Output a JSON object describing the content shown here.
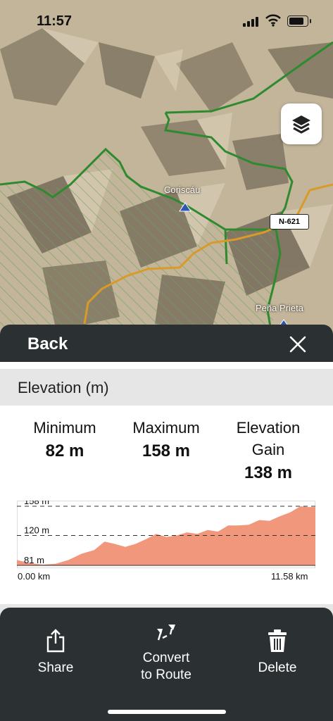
{
  "status_bar": {
    "time": "11:57"
  },
  "map": {
    "labels": {
      "place_1": "Coriscáu",
      "place_2": "Peña Prieta",
      "road": "N-621"
    },
    "icons": {
      "layers": "layers-icon",
      "peak": "mountain-peak-icon"
    }
  },
  "panel": {
    "back_label": "Back",
    "close_icon": "close-icon",
    "section_title": "Elevation (m)",
    "stats": [
      {
        "label": "Minimum",
        "value": "82 m"
      },
      {
        "label": "Maximum",
        "value": "158 m"
      },
      {
        "label": "Elevation Gain",
        "value": "138 m"
      }
    ]
  },
  "chart_data": {
    "type": "area",
    "title": "",
    "xlabel": "",
    "ylabel": "",
    "x_unit": "km",
    "y_unit": "m",
    "x_range": [
      0,
      11.58
    ],
    "ylim": [
      81,
      158
    ],
    "y_ticks": [
      "158 m",
      "120 m",
      "81 m"
    ],
    "x_ticks": [
      "0.00 km",
      "11.58 km"
    ],
    "x": [
      0,
      0.5,
      1.0,
      1.5,
      2.0,
      2.5,
      3.0,
      3.4,
      3.8,
      4.2,
      4.6,
      5.0,
      5.4,
      5.8,
      6.2,
      6.6,
      7.0,
      7.4,
      7.8,
      8.2,
      8.6,
      9.0,
      9.4,
      9.8,
      10.2,
      10.6,
      11.0,
      11.3,
      11.58
    ],
    "y": [
      88,
      84,
      82,
      83,
      88,
      96,
      101,
      112,
      109,
      105,
      109,
      115,
      122,
      118,
      120,
      124,
      122,
      127,
      125,
      133,
      133,
      134,
      140,
      139,
      145,
      150,
      158,
      157,
      157
    ],
    "color": "#f0977c",
    "grid": "dashed reference lines at 158 m and 120 m"
  },
  "toolbar": {
    "share_label": "Share",
    "convert_label_1": "Convert",
    "convert_label_2": "to Route",
    "delete_label": "Delete",
    "icons": {
      "share": "share-icon",
      "convert": "convert-to-route-icon",
      "delete": "trash-icon"
    }
  }
}
